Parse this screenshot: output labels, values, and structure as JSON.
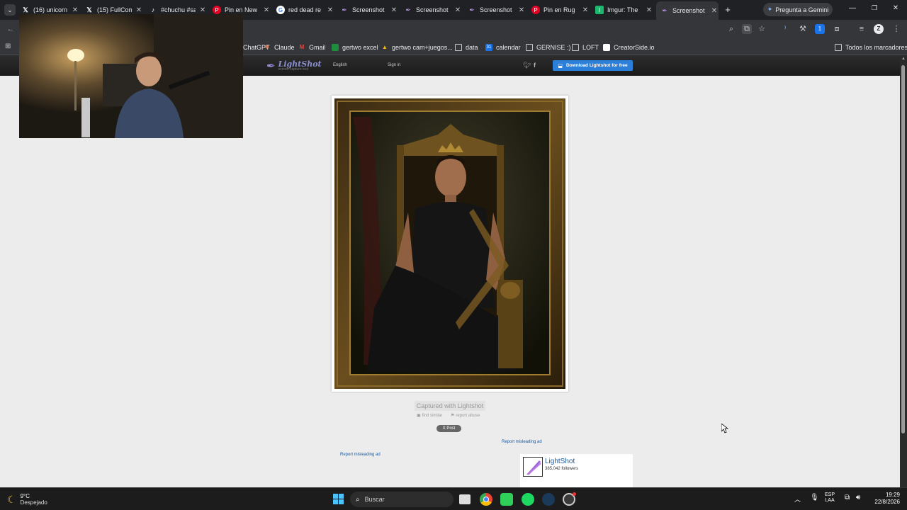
{
  "tabs": [
    {
      "title": "(16) unicorn",
      "icon": "x-icon"
    },
    {
      "title": "(15) FullCom",
      "icon": "x-icon"
    },
    {
      "title": "#chuchu #sa",
      "icon": "tiktok-icon"
    },
    {
      "title": "Pin en New",
      "icon": "pinterest-icon"
    },
    {
      "title": "red dead re",
      "icon": "google-icon"
    },
    {
      "title": "Screenshot",
      "icon": "lightshot-icon"
    },
    {
      "title": "Screenshot",
      "icon": "lightshot-icon"
    },
    {
      "title": "Screenshot",
      "icon": "lightshot-icon"
    },
    {
      "title": "Pin en Rug",
      "icon": "pinterest-icon"
    },
    {
      "title": "Imgur: The",
      "icon": "imgur-icon"
    },
    {
      "title": "Screenshot",
      "icon": "lightshot-icon"
    }
  ],
  "gemini_button": "Pregunta a Gemini",
  "bookmarks": {
    "items": [
      "ChatGPT",
      "Claude",
      "Gmail",
      "gertwo excel",
      "gertwo cam+juegos...",
      "data",
      "calendar",
      "GERNISE :)",
      "LOFT",
      "CreatorSide.io"
    ],
    "all_bookmarks": "Todos los marcadores"
  },
  "lightshot_header": {
    "logo_text": "LightShot",
    "logo_sub": "screen capture tool",
    "language": "English",
    "sign_in": "Sign in",
    "download_button": "Download Lightshot for free"
  },
  "screenshot": {
    "caption": "Captured with Lightshot",
    "find_similar": "find similar",
    "report_abuse": "report abuse",
    "post_button": "X Post"
  },
  "ads": {
    "report_left": "Report misleading ad",
    "report_right": "Report misleading ad",
    "widget_name": "LightShot",
    "widget_followers": "385,042 followers"
  },
  "taskbar": {
    "weather_temp": "9°C",
    "weather_desc": "Despejado",
    "search_placeholder": "Buscar",
    "lang_top": "ESP",
    "lang_bottom": "LAA",
    "time": "19:29",
    "date": "22/8/2026"
  },
  "colors": {
    "download_button": "#2c7fd8",
    "page_bg": "#ececec",
    "link": "#1a5aa0"
  }
}
